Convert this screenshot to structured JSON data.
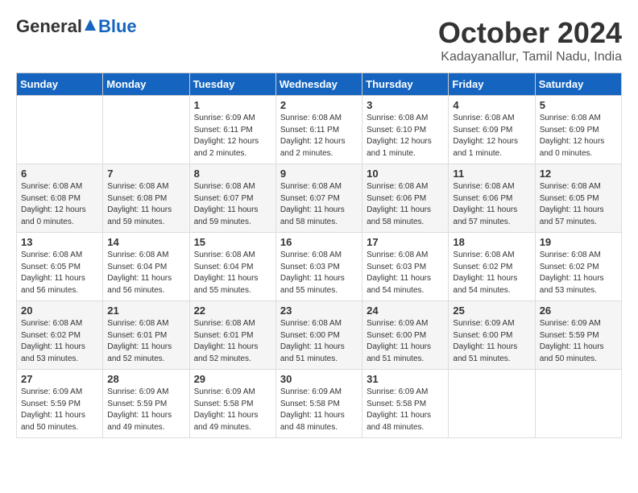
{
  "header": {
    "logo_general": "General",
    "logo_blue": "Blue",
    "month_title": "October 2024",
    "location": "Kadayanallur, Tamil Nadu, India"
  },
  "days_of_week": [
    "Sunday",
    "Monday",
    "Tuesday",
    "Wednesday",
    "Thursday",
    "Friday",
    "Saturday"
  ],
  "weeks": [
    [
      {
        "day": "",
        "sunrise": "",
        "sunset": "",
        "daylight": ""
      },
      {
        "day": "",
        "sunrise": "",
        "sunset": "",
        "daylight": ""
      },
      {
        "day": "1",
        "sunrise": "Sunrise: 6:09 AM",
        "sunset": "Sunset: 6:11 PM",
        "daylight": "Daylight: 12 hours and 2 minutes."
      },
      {
        "day": "2",
        "sunrise": "Sunrise: 6:08 AM",
        "sunset": "Sunset: 6:11 PM",
        "daylight": "Daylight: 12 hours and 2 minutes."
      },
      {
        "day": "3",
        "sunrise": "Sunrise: 6:08 AM",
        "sunset": "Sunset: 6:10 PM",
        "daylight": "Daylight: 12 hours and 1 minute."
      },
      {
        "day": "4",
        "sunrise": "Sunrise: 6:08 AM",
        "sunset": "Sunset: 6:09 PM",
        "daylight": "Daylight: 12 hours and 1 minute."
      },
      {
        "day": "5",
        "sunrise": "Sunrise: 6:08 AM",
        "sunset": "Sunset: 6:09 PM",
        "daylight": "Daylight: 12 hours and 0 minutes."
      }
    ],
    [
      {
        "day": "6",
        "sunrise": "Sunrise: 6:08 AM",
        "sunset": "Sunset: 6:08 PM",
        "daylight": "Daylight: 12 hours and 0 minutes."
      },
      {
        "day": "7",
        "sunrise": "Sunrise: 6:08 AM",
        "sunset": "Sunset: 6:08 PM",
        "daylight": "Daylight: 11 hours and 59 minutes."
      },
      {
        "day": "8",
        "sunrise": "Sunrise: 6:08 AM",
        "sunset": "Sunset: 6:07 PM",
        "daylight": "Daylight: 11 hours and 59 minutes."
      },
      {
        "day": "9",
        "sunrise": "Sunrise: 6:08 AM",
        "sunset": "Sunset: 6:07 PM",
        "daylight": "Daylight: 11 hours and 58 minutes."
      },
      {
        "day": "10",
        "sunrise": "Sunrise: 6:08 AM",
        "sunset": "Sunset: 6:06 PM",
        "daylight": "Daylight: 11 hours and 58 minutes."
      },
      {
        "day": "11",
        "sunrise": "Sunrise: 6:08 AM",
        "sunset": "Sunset: 6:06 PM",
        "daylight": "Daylight: 11 hours and 57 minutes."
      },
      {
        "day": "12",
        "sunrise": "Sunrise: 6:08 AM",
        "sunset": "Sunset: 6:05 PM",
        "daylight": "Daylight: 11 hours and 57 minutes."
      }
    ],
    [
      {
        "day": "13",
        "sunrise": "Sunrise: 6:08 AM",
        "sunset": "Sunset: 6:05 PM",
        "daylight": "Daylight: 11 hours and 56 minutes."
      },
      {
        "day": "14",
        "sunrise": "Sunrise: 6:08 AM",
        "sunset": "Sunset: 6:04 PM",
        "daylight": "Daylight: 11 hours and 56 minutes."
      },
      {
        "day": "15",
        "sunrise": "Sunrise: 6:08 AM",
        "sunset": "Sunset: 6:04 PM",
        "daylight": "Daylight: 11 hours and 55 minutes."
      },
      {
        "day": "16",
        "sunrise": "Sunrise: 6:08 AM",
        "sunset": "Sunset: 6:03 PM",
        "daylight": "Daylight: 11 hours and 55 minutes."
      },
      {
        "day": "17",
        "sunrise": "Sunrise: 6:08 AM",
        "sunset": "Sunset: 6:03 PM",
        "daylight": "Daylight: 11 hours and 54 minutes."
      },
      {
        "day": "18",
        "sunrise": "Sunrise: 6:08 AM",
        "sunset": "Sunset: 6:02 PM",
        "daylight": "Daylight: 11 hours and 54 minutes."
      },
      {
        "day": "19",
        "sunrise": "Sunrise: 6:08 AM",
        "sunset": "Sunset: 6:02 PM",
        "daylight": "Daylight: 11 hours and 53 minutes."
      }
    ],
    [
      {
        "day": "20",
        "sunrise": "Sunrise: 6:08 AM",
        "sunset": "Sunset: 6:02 PM",
        "daylight": "Daylight: 11 hours and 53 minutes."
      },
      {
        "day": "21",
        "sunrise": "Sunrise: 6:08 AM",
        "sunset": "Sunset: 6:01 PM",
        "daylight": "Daylight: 11 hours and 52 minutes."
      },
      {
        "day": "22",
        "sunrise": "Sunrise: 6:08 AM",
        "sunset": "Sunset: 6:01 PM",
        "daylight": "Daylight: 11 hours and 52 minutes."
      },
      {
        "day": "23",
        "sunrise": "Sunrise: 6:08 AM",
        "sunset": "Sunset: 6:00 PM",
        "daylight": "Daylight: 11 hours and 51 minutes."
      },
      {
        "day": "24",
        "sunrise": "Sunrise: 6:09 AM",
        "sunset": "Sunset: 6:00 PM",
        "daylight": "Daylight: 11 hours and 51 minutes."
      },
      {
        "day": "25",
        "sunrise": "Sunrise: 6:09 AM",
        "sunset": "Sunset: 6:00 PM",
        "daylight": "Daylight: 11 hours and 51 minutes."
      },
      {
        "day": "26",
        "sunrise": "Sunrise: 6:09 AM",
        "sunset": "Sunset: 5:59 PM",
        "daylight": "Daylight: 11 hours and 50 minutes."
      }
    ],
    [
      {
        "day": "27",
        "sunrise": "Sunrise: 6:09 AM",
        "sunset": "Sunset: 5:59 PM",
        "daylight": "Daylight: 11 hours and 50 minutes."
      },
      {
        "day": "28",
        "sunrise": "Sunrise: 6:09 AM",
        "sunset": "Sunset: 5:59 PM",
        "daylight": "Daylight: 11 hours and 49 minutes."
      },
      {
        "day": "29",
        "sunrise": "Sunrise: 6:09 AM",
        "sunset": "Sunset: 5:58 PM",
        "daylight": "Daylight: 11 hours and 49 minutes."
      },
      {
        "day": "30",
        "sunrise": "Sunrise: 6:09 AM",
        "sunset": "Sunset: 5:58 PM",
        "daylight": "Daylight: 11 hours and 48 minutes."
      },
      {
        "day": "31",
        "sunrise": "Sunrise: 6:09 AM",
        "sunset": "Sunset: 5:58 PM",
        "daylight": "Daylight: 11 hours and 48 minutes."
      },
      {
        "day": "",
        "sunrise": "",
        "sunset": "",
        "daylight": ""
      },
      {
        "day": "",
        "sunrise": "",
        "sunset": "",
        "daylight": ""
      }
    ]
  ]
}
